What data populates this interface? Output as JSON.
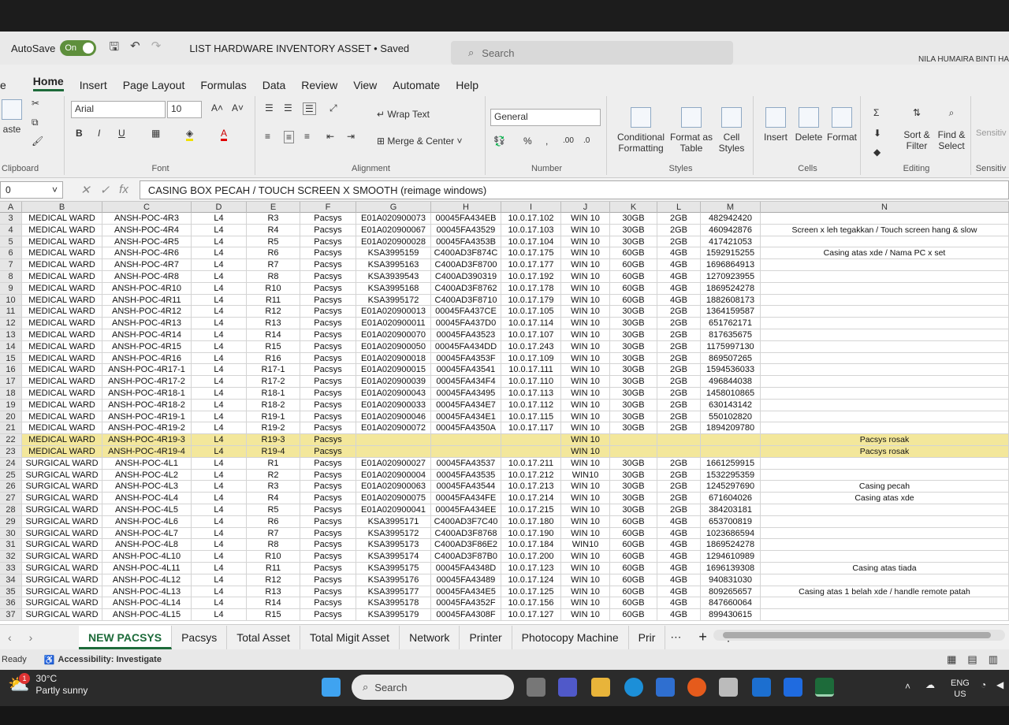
{
  "titlebar": {
    "autosave_label": "AutoSave",
    "autosave_state": "On",
    "doc_title": "LIST HARDWARE INVENTORY ASSET • Saved",
    "search_placeholder": "Search",
    "user": "NILA HUMAIRA BINTI HA"
  },
  "menu": [
    "e",
    "Home",
    "Insert",
    "Page Layout",
    "Formulas",
    "Data",
    "Review",
    "View",
    "Automate",
    "Help"
  ],
  "ribbon": {
    "clipboard": {
      "paste": "aste",
      "label": "Clipboard"
    },
    "font": {
      "name": "Arial",
      "size": "10",
      "label": "Font"
    },
    "alignment": {
      "wrap": "Wrap Text",
      "merge": "Merge & Center",
      "label": "Alignment"
    },
    "number": {
      "format": "General",
      "label": "Number"
    },
    "styles": {
      "cond": "Conditional Formatting",
      "table": "Format as Table",
      "cell": "Cell Styles",
      "label": "Styles"
    },
    "cells": {
      "insert": "Insert",
      "delete": "Delete",
      "format": "Format",
      "label": "Cells"
    },
    "editing": {
      "sort": "Sort & Filter",
      "find": "Find & Select",
      "label": "Editing"
    },
    "sensitivity": {
      "btn": "Sensitiv",
      "label": "Sensitiv"
    }
  },
  "formula": {
    "namebox": "0",
    "fx": "fx",
    "content": "CASING BOX PECAH / TOUCH SCREEN X SMOOTH (reimage windows)"
  },
  "columns": [
    "A",
    "B",
    "C",
    "D",
    "E",
    "F",
    "G",
    "H",
    "I",
    "J",
    "K",
    "L",
    "M",
    "N"
  ],
  "rows": [
    [
      "3",
      "MEDICAL WARD",
      "ANSH-POC-4R3",
      "L4",
      "R3",
      "Pacsys",
      "E01A020900073",
      "00045FA434EB",
      "10.0.17.102",
      "WIN 10",
      "30GB",
      "2GB",
      "482942420",
      ""
    ],
    [
      "4",
      "MEDICAL WARD",
      "ANSH-POC-4R4",
      "L4",
      "R4",
      "Pacsys",
      "E01A020900067",
      "00045FA43529",
      "10.0.17.103",
      "WIN 10",
      "30GB",
      "2GB",
      "460942876",
      "Screen x leh tegakkan / Touch screen hang & slow"
    ],
    [
      "5",
      "MEDICAL WARD",
      "ANSH-POC-4R5",
      "L4",
      "R5",
      "Pacsys",
      "E01A020900028",
      "00045FA4353B",
      "10.0.17.104",
      "WIN 10",
      "30GB",
      "2GB",
      "417421053",
      ""
    ],
    [
      "6",
      "MEDICAL WARD",
      "ANSH-POC-4R6",
      "L4",
      "R6",
      "Pacsys",
      "KSA3995159",
      "C400AD3F874C",
      "10.0.17.175",
      "WIN 10",
      "60GB",
      "4GB",
      "1592915255",
      "Casing atas xde / Nama PC x set"
    ],
    [
      "7",
      "MEDICAL WARD",
      "ANSH-POC-4R7",
      "L4",
      "R7",
      "Pacsys",
      "KSA3995163",
      "C400AD3F8700",
      "10.0.17.177",
      "WIN 10",
      "60GB",
      "4GB",
      "1696864913",
      ""
    ],
    [
      "8",
      "MEDICAL WARD",
      "ANSH-POC-4R8",
      "L4",
      "R8",
      "Pacsys",
      "KSA3939543",
      "C400AD390319",
      "10.0.17.192",
      "WIN 10",
      "60GB",
      "4GB",
      "1270923955",
      ""
    ],
    [
      "9",
      "MEDICAL WARD",
      "ANSH-POC-4R10",
      "L4",
      "R10",
      "Pacsys",
      "KSA3995168",
      "C400AD3F8762",
      "10.0.17.178",
      "WIN 10",
      "60GB",
      "4GB",
      "1869524278",
      ""
    ],
    [
      "10",
      "MEDICAL WARD",
      "ANSH-POC-4R11",
      "L4",
      "R11",
      "Pacsys",
      "KSA3995172",
      "C400AD3F8710",
      "10.0.17.179",
      "WIN 10",
      "60GB",
      "4GB",
      "1882608173",
      ""
    ],
    [
      "11",
      "MEDICAL WARD",
      "ANSH-POC-4R12",
      "L4",
      "R12",
      "Pacsys",
      "E01A020900013",
      "00045FA437CE",
      "10.0.17.105",
      "WIN 10",
      "30GB",
      "2GB",
      "1364159587",
      ""
    ],
    [
      "12",
      "MEDICAL WARD",
      "ANSH-POC-4R13",
      "L4",
      "R13",
      "Pacsys",
      "E01A020900011",
      "00045FA437D0",
      "10.0.17.114",
      "WIN 10",
      "30GB",
      "2GB",
      "651762171",
      ""
    ],
    [
      "13",
      "MEDICAL WARD",
      "ANSH-POC-4R14",
      "L4",
      "R14",
      "Pacsys",
      "E01A020900070",
      "00045FA43523",
      "10.0.17.107",
      "WIN 10",
      "30GB",
      "2GB",
      "817635675",
      ""
    ],
    [
      "14",
      "MEDICAL WARD",
      "ANSH-POC-4R15",
      "L4",
      "R15",
      "Pacsys",
      "E01A020900050",
      "00045FA434DD",
      "10.0.17.243",
      "WIN 10",
      "30GB",
      "2GB",
      "1175997130",
      ""
    ],
    [
      "15",
      "MEDICAL WARD",
      "ANSH-POC-4R16",
      "L4",
      "R16",
      "Pacsys",
      "E01A020900018",
      "00045FA4353F",
      "10.0.17.109",
      "WIN 10",
      "30GB",
      "2GB",
      "869507265",
      ""
    ],
    [
      "16",
      "MEDICAL WARD",
      "ANSH-POC-4R17-1",
      "L4",
      "R17-1",
      "Pacsys",
      "E01A020900015",
      "00045FA43541",
      "10.0.17.111",
      "WIN 10",
      "30GB",
      "2GB",
      "1594536033",
      ""
    ],
    [
      "17",
      "MEDICAL WARD",
      "ANSH-POC-4R17-2",
      "L4",
      "R17-2",
      "Pacsys",
      "E01A020900039",
      "00045FA434F4",
      "10.0.17.110",
      "WIN 10",
      "30GB",
      "2GB",
      "496844038",
      ""
    ],
    [
      "18",
      "MEDICAL WARD",
      "ANSH-POC-4R18-1",
      "L4",
      "R18-1",
      "Pacsys",
      "E01A020900043",
      "00045FA43495",
      "10.0.17.113",
      "WIN 10",
      "30GB",
      "2GB",
      "1458010865",
      ""
    ],
    [
      "19",
      "MEDICAL WARD",
      "ANSH-POC-4R18-2",
      "L4",
      "R18-2",
      "Pacsys",
      "E01A020900033",
      "00045FA434E7",
      "10.0.17.112",
      "WIN 10",
      "30GB",
      "2GB",
      "630143142",
      ""
    ],
    [
      "20",
      "MEDICAL WARD",
      "ANSH-POC-4R19-1",
      "L4",
      "R19-1",
      "Pacsys",
      "E01A020900046",
      "00045FA434E1",
      "10.0.17.115",
      "WIN 10",
      "30GB",
      "2GB",
      "550102820",
      ""
    ],
    [
      "21",
      "MEDICAL WARD",
      "ANSH-POC-4R19-2",
      "L4",
      "R19-2",
      "Pacsys",
      "E01A020900072",
      "00045FA4350A",
      "10.0.17.117",
      "WIN 10",
      "30GB",
      "2GB",
      "1894209780",
      ""
    ],
    [
      "22",
      "MEDICAL WARD",
      "ANSH-POC-4R19-3",
      "L4",
      "R19-3",
      "Pacsys",
      "",
      "",
      "",
      "WIN 10",
      "",
      "",
      "",
      "Pacsys rosak"
    ],
    [
      "23",
      "MEDICAL WARD",
      "ANSH-POC-4R19-4",
      "L4",
      "R19-4",
      "Pacsys",
      "",
      "",
      "",
      "WIN 10",
      "",
      "",
      "",
      "Pacsys rosak"
    ],
    [
      "24",
      "SURGICAL WARD",
      "ANSH-POC-4L1",
      "L4",
      "R1",
      "Pacsys",
      "E01A020900027",
      "00045FA43537",
      "10.0.17.211",
      "WIN 10",
      "30GB",
      "2GB",
      "1661259915",
      ""
    ],
    [
      "25",
      "SURGICAL WARD",
      "ANSH-POC-4L2",
      "L4",
      "R2",
      "Pacsys",
      "E01A020900004",
      "00045FA43535",
      "10.0.17.212",
      "WIN10",
      "30GB",
      "2GB",
      "1532295359",
      ""
    ],
    [
      "26",
      "SURGICAL WARD",
      "ANSH-POC-4L3",
      "L4",
      "R3",
      "Pacsys",
      "E01A020900063",
      "00045FA43544",
      "10.0.17.213",
      "WIN 10",
      "30GB",
      "2GB",
      "1245297690",
      "Casing pecah"
    ],
    [
      "27",
      "SURGICAL WARD",
      "ANSH-POC-4L4",
      "L4",
      "R4",
      "Pacsys",
      "E01A020900075",
      "00045FA434FE",
      "10.0.17.214",
      "WIN 10",
      "30GB",
      "2GB",
      "671604026",
      "Casing atas xde"
    ],
    [
      "28",
      "SURGICAL WARD",
      "ANSH-POC-4L5",
      "L4",
      "R5",
      "Pacsys",
      "E01A020900041",
      "00045FA434EE",
      "10.0.17.215",
      "WIN 10",
      "30GB",
      "2GB",
      "384203181",
      ""
    ],
    [
      "29",
      "SURGICAL WARD",
      "ANSH-POC-4L6",
      "L4",
      "R6",
      "Pacsys",
      "KSA3995171",
      "C400AD3F7C40",
      "10.0.17.180",
      "WIN 10",
      "60GB",
      "4GB",
      "653700819",
      ""
    ],
    [
      "30",
      "SURGICAL WARD",
      "ANSH-POC-4L7",
      "L4",
      "R7",
      "Pacsys",
      "KSA3995172",
      "C400AD3F8768",
      "10.0.17.190",
      "WIN 10",
      "60GB",
      "4GB",
      "1023686594",
      ""
    ],
    [
      "31",
      "SURGICAL WARD",
      "ANSH-POC-4L8",
      "L4",
      "R8",
      "Pacsys",
      "KSA3995173",
      "C400AD3F86E2",
      "10.0.17.184",
      "WIN10",
      "60GB",
      "4GB",
      "1869524278",
      ""
    ],
    [
      "32",
      "SURGICAL WARD",
      "ANSH-POC-4L10",
      "L4",
      "R10",
      "Pacsys",
      "KSA3995174",
      "C400AD3F87B0",
      "10.0.17.200",
      "WIN 10",
      "60GB",
      "4GB",
      "1294610989",
      ""
    ],
    [
      "33",
      "SURGICAL WARD",
      "ANSH-POC-4L11",
      "L4",
      "R11",
      "Pacsys",
      "KSA3995175",
      "00045FA4348D",
      "10.0.17.123",
      "WIN 10",
      "60GB",
      "4GB",
      "1696139308",
      "Casing atas tiada"
    ],
    [
      "34",
      "SURGICAL WARD",
      "ANSH-POC-4L12",
      "L4",
      "R12",
      "Pacsys",
      "KSA3995176",
      "00045FA43489",
      "10.0.17.124",
      "WIN 10",
      "60GB",
      "4GB",
      "940831030",
      ""
    ],
    [
      "35",
      "SURGICAL WARD",
      "ANSH-POC-4L13",
      "L4",
      "R13",
      "Pacsys",
      "KSA3995177",
      "00045FA434E5",
      "10.0.17.125",
      "WIN 10",
      "60GB",
      "4GB",
      "809265657",
      "Casing atas 1 belah xde / handle remote patah"
    ],
    [
      "36",
      "SURGICAL WARD",
      "ANSH-POC-4L14",
      "L4",
      "R14",
      "Pacsys",
      "KSA3995178",
      "00045FA4352F",
      "10.0.17.156",
      "WIN 10",
      "60GB",
      "4GB",
      "847660064",
      ""
    ],
    [
      "37",
      "SURGICAL WARD",
      "ANSH-POC-4L15",
      "L4",
      "R15",
      "Pacsys",
      "KSA3995179",
      "00045FA4308F",
      "10.0.17.127",
      "WIN 10",
      "60GB",
      "4GB",
      "899430615",
      ""
    ]
  ],
  "row_highlight": {
    "22": "#f3e79b",
    "23": "#f3e79b"
  },
  "tabs": [
    "NEW PACSYS",
    "Pacsys",
    "Total Asset",
    "Total Migit Asset",
    "Network",
    "Printer",
    "Photocopy Machine",
    "Prir"
  ],
  "active_tab": "NEW PACSYS",
  "status": {
    "ready": "Ready",
    "accessibility": "Accessibility: Investigate"
  },
  "weather": {
    "temp": "30°C",
    "desc": "Partly sunny",
    "badge": "1"
  },
  "taskbar": {
    "search": "Search",
    "lang1": "ENG",
    "lang2": "US"
  },
  "colors": {
    "accent": "#1d6b3a",
    "grid_line": "#d4d4d4",
    "highlight_yellow": "#f3e79b"
  }
}
